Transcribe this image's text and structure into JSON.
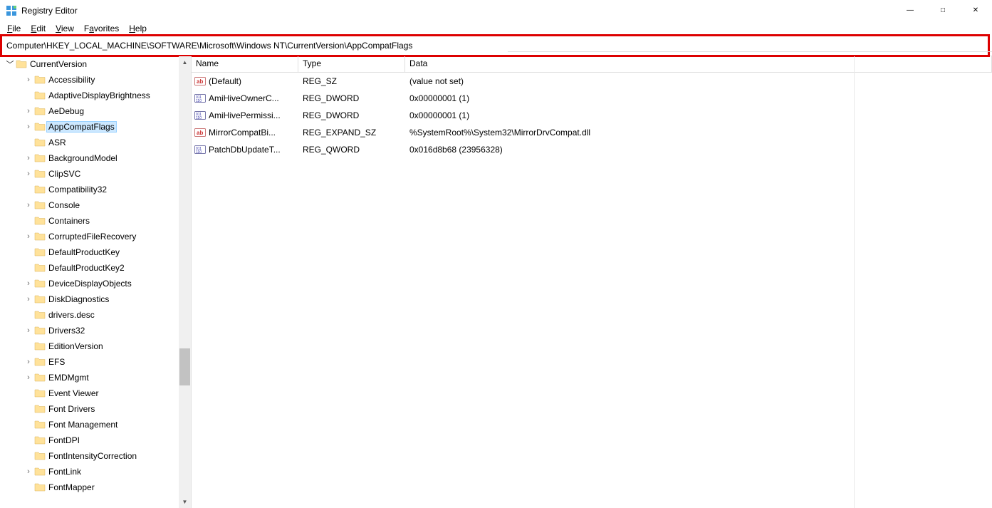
{
  "window": {
    "title": "Registry Editor"
  },
  "menu": {
    "file": "File",
    "edit": "Edit",
    "view": "View",
    "favorites": "Favorites",
    "help": "Help"
  },
  "address": "Computer\\HKEY_LOCAL_MACHINE\\SOFTWARE\\Microsoft\\Windows NT\\CurrentVersion\\AppCompatFlags",
  "tree": {
    "root": {
      "label": "CurrentVersion",
      "expandable": true,
      "open": true,
      "indent": 1
    },
    "items": [
      {
        "label": "Accessibility",
        "expandable": true,
        "indent": 2
      },
      {
        "label": "AdaptiveDisplayBrightness",
        "expandable": false,
        "indent": 2
      },
      {
        "label": "AeDebug",
        "expandable": true,
        "indent": 2
      },
      {
        "label": "AppCompatFlags",
        "expandable": true,
        "indent": 2,
        "selected": true
      },
      {
        "label": "ASR",
        "expandable": false,
        "indent": 2
      },
      {
        "label": "BackgroundModel",
        "expandable": true,
        "indent": 2
      },
      {
        "label": "ClipSVC",
        "expandable": true,
        "indent": 2
      },
      {
        "label": "Compatibility32",
        "expandable": false,
        "indent": 2
      },
      {
        "label": "Console",
        "expandable": true,
        "indent": 2
      },
      {
        "label": "Containers",
        "expandable": false,
        "indent": 2
      },
      {
        "label": "CorruptedFileRecovery",
        "expandable": true,
        "indent": 2
      },
      {
        "label": "DefaultProductKey",
        "expandable": false,
        "indent": 2
      },
      {
        "label": "DefaultProductKey2",
        "expandable": false,
        "indent": 2
      },
      {
        "label": "DeviceDisplayObjects",
        "expandable": true,
        "indent": 2
      },
      {
        "label": "DiskDiagnostics",
        "expandable": true,
        "indent": 2
      },
      {
        "label": "drivers.desc",
        "expandable": false,
        "indent": 2
      },
      {
        "label": "Drivers32",
        "expandable": true,
        "indent": 2
      },
      {
        "label": "EditionVersion",
        "expandable": false,
        "indent": 2
      },
      {
        "label": "EFS",
        "expandable": true,
        "indent": 2
      },
      {
        "label": "EMDMgmt",
        "expandable": true,
        "indent": 2
      },
      {
        "label": "Event Viewer",
        "expandable": false,
        "indent": 2
      },
      {
        "label": "Font Drivers",
        "expandable": false,
        "indent": 2
      },
      {
        "label": "Font Management",
        "expandable": false,
        "indent": 2
      },
      {
        "label": "FontDPI",
        "expandable": false,
        "indent": 2
      },
      {
        "label": "FontIntensityCorrection",
        "expandable": false,
        "indent": 2
      },
      {
        "label": "FontLink",
        "expandable": true,
        "indent": 2
      },
      {
        "label": "FontMapper",
        "expandable": false,
        "indent": 2
      }
    ]
  },
  "columns": {
    "name": "Name",
    "type": "Type",
    "data": "Data"
  },
  "values": [
    {
      "icon": "sz",
      "name": "(Default)",
      "type": "REG_SZ",
      "data": "(value not set)"
    },
    {
      "icon": "bin",
      "name": "AmiHiveOwnerC...",
      "type": "REG_DWORD",
      "data": "0x00000001 (1)"
    },
    {
      "icon": "bin",
      "name": "AmiHivePermissi...",
      "type": "REG_DWORD",
      "data": "0x00000001 (1)"
    },
    {
      "icon": "sz",
      "name": "MirrorCompatBi...",
      "type": "REG_EXPAND_SZ",
      "data": "%SystemRoot%\\System32\\MirrorDrvCompat.dll"
    },
    {
      "icon": "bin",
      "name": "PatchDbUpdateT...",
      "type": "REG_QWORD",
      "data": "0x016d8b68 (23956328)"
    }
  ]
}
